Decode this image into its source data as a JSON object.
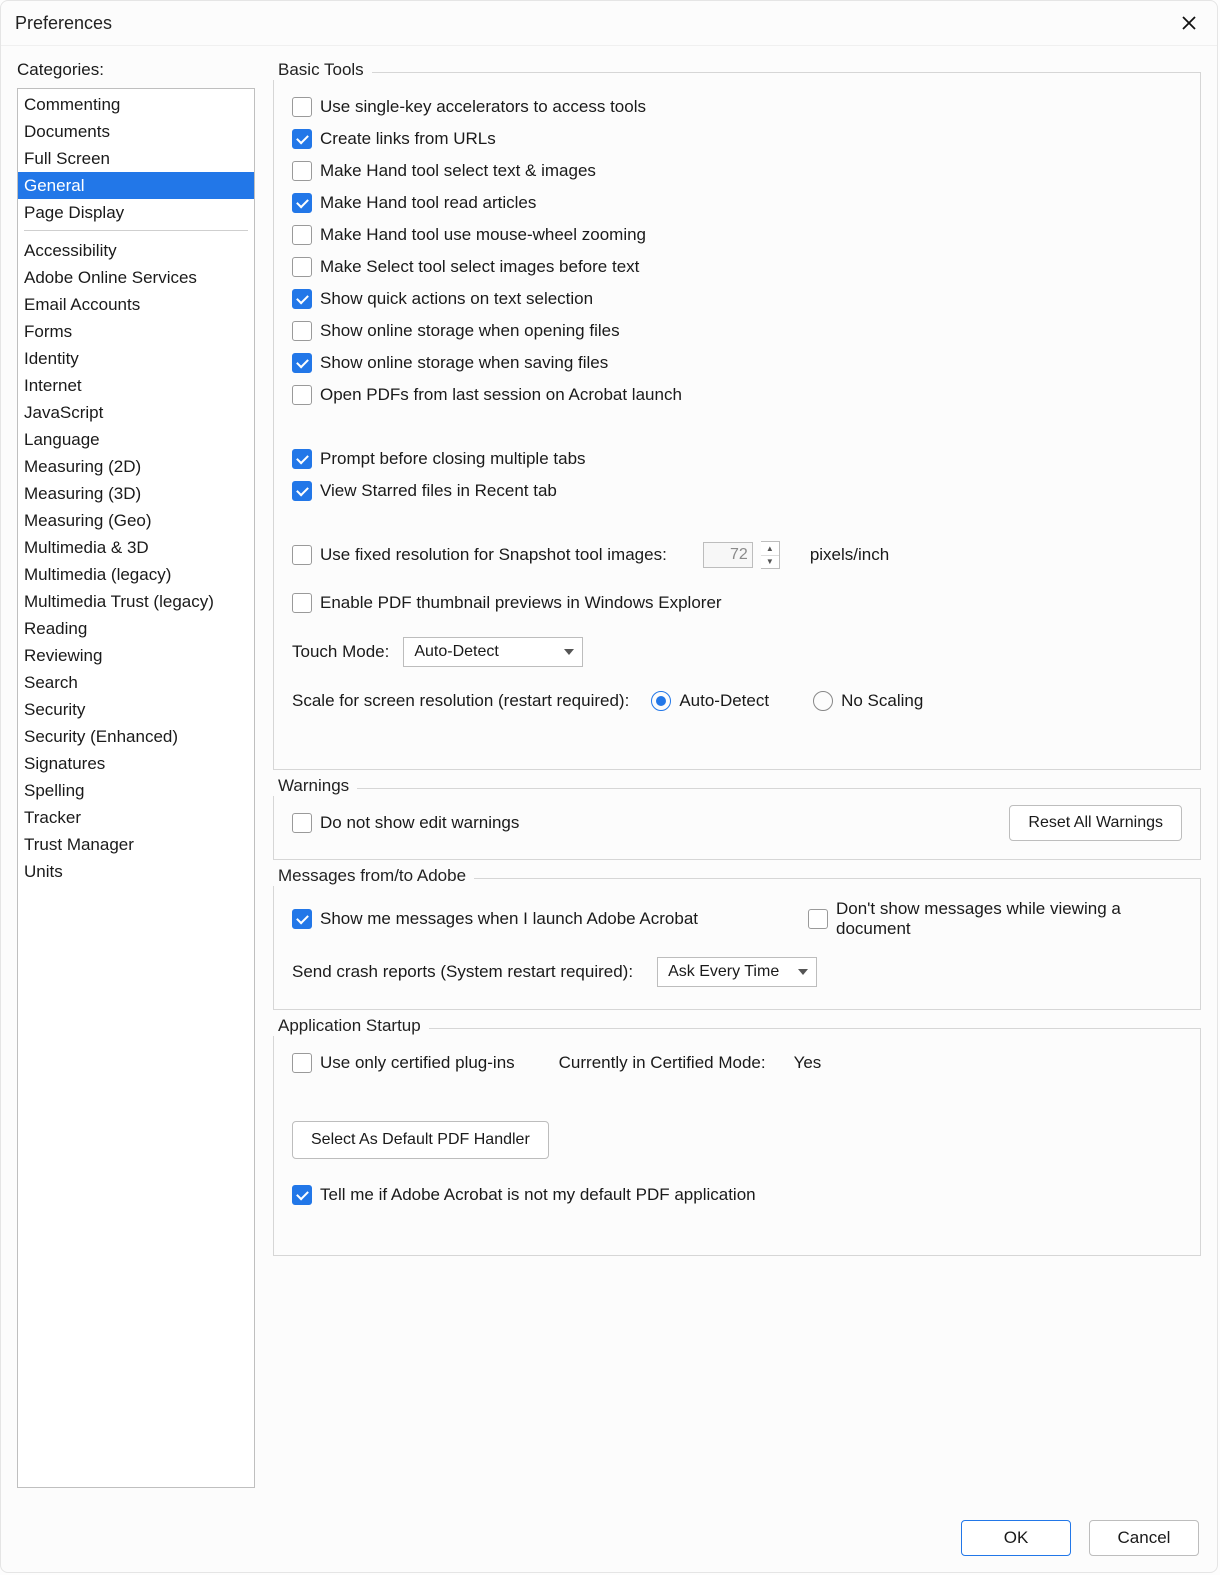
{
  "window": {
    "title": "Preferences"
  },
  "sidebar": {
    "label": "Categories:",
    "primary": [
      "Commenting",
      "Documents",
      "Full Screen",
      "General",
      "Page Display"
    ],
    "selected": "General",
    "secondary": [
      "Accessibility",
      "Adobe Online Services",
      "Email Accounts",
      "Forms",
      "Identity",
      "Internet",
      "JavaScript",
      "Language",
      "Measuring (2D)",
      "Measuring (3D)",
      "Measuring (Geo)",
      "Multimedia & 3D",
      "Multimedia (legacy)",
      "Multimedia Trust (legacy)",
      "Reading",
      "Reviewing",
      "Search",
      "Security",
      "Security (Enhanced)",
      "Signatures",
      "Spelling",
      "Tracker",
      "Trust Manager",
      "Units"
    ]
  },
  "basic_tools": {
    "title": "Basic Tools",
    "items": [
      {
        "label": "Use single-key accelerators to access tools",
        "checked": false
      },
      {
        "label": "Create links from URLs",
        "checked": true
      },
      {
        "label": "Make Hand tool select text & images",
        "checked": false
      },
      {
        "label": "Make Hand tool read articles",
        "checked": true
      },
      {
        "label": "Make Hand tool use mouse-wheel zooming",
        "checked": false
      },
      {
        "label": "Make Select tool select images before text",
        "checked": false
      },
      {
        "label": "Show quick actions on text selection",
        "checked": true
      },
      {
        "label": "Show online storage when opening files",
        "checked": false
      },
      {
        "label": "Show online storage when saving files",
        "checked": true
      },
      {
        "label": "Open PDFs from last session on Acrobat launch",
        "checked": false
      }
    ],
    "items2": [
      {
        "label": "Prompt before closing multiple tabs",
        "checked": true
      },
      {
        "label": "View Starred files in Recent tab",
        "checked": true
      }
    ],
    "fixed_res": {
      "label": "Use fixed resolution for Snapshot tool images:",
      "checked": false,
      "value": "72",
      "unit": "pixels/inch"
    },
    "thumb": {
      "label": "Enable PDF thumbnail previews in Windows Explorer",
      "checked": false
    },
    "touch_label": "Touch Mode:",
    "touch_value": "Auto-Detect",
    "scale_label": "Scale for screen resolution (restart required):",
    "scale_opts": [
      {
        "label": "Auto-Detect",
        "checked": true
      },
      {
        "label": "No Scaling",
        "checked": false
      }
    ]
  },
  "warnings": {
    "title": "Warnings",
    "item": {
      "label": "Do not show edit warnings",
      "checked": false
    },
    "reset": "Reset All Warnings"
  },
  "messages": {
    "title": "Messages from/to Adobe",
    "left": {
      "label": "Show me messages when I launch Adobe Acrobat",
      "checked": true
    },
    "right": {
      "label": "Don't show messages while viewing a document",
      "checked": false
    },
    "crash_label": "Send crash reports (System restart required):",
    "crash_value": "Ask Every Time"
  },
  "startup": {
    "title": "Application Startup",
    "plugins": {
      "label": "Use only certified plug-ins",
      "checked": false
    },
    "cert_label": "Currently in Certified Mode:",
    "cert_value": "Yes",
    "default_btn": "Select As Default PDF Handler",
    "tell": {
      "label": "Tell me if Adobe Acrobat is not my default PDF application",
      "checked": true
    }
  },
  "footer": {
    "ok": "OK",
    "cancel": "Cancel"
  }
}
